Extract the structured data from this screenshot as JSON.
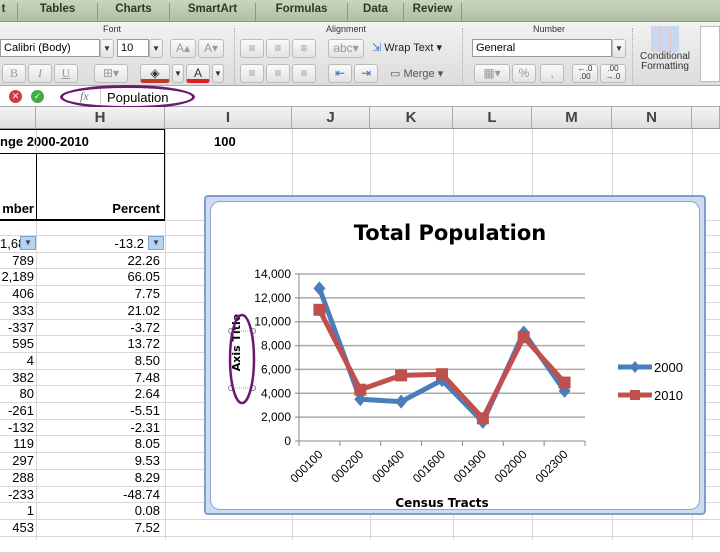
{
  "ribbon": {
    "tabs": [
      "t",
      "Tables",
      "Charts",
      "SmartArt",
      "Formulas",
      "Data",
      "Review"
    ],
    "groups": {
      "font": "Font",
      "alignment": "Alignment",
      "number": "Number"
    },
    "font_name": "Calibri (Body)",
    "font_size": "10",
    "bold": "B",
    "italic": "I",
    "underline": "U",
    "wrap_text": "Wrap Text",
    "merge": "Merge",
    "number_format": "General",
    "percent": "%",
    "comma": ",",
    "conditional_formatting": [
      "Conditional",
      "Formatting"
    ],
    "icons": [
      "increase-font-icon",
      "decrease-font-icon",
      "borders-icon",
      "fill-color-icon",
      "font-color-icon",
      "align-icons",
      "indent-icons",
      "wrap-text-icon",
      "merge-icon",
      "currency-icon",
      "increase-decimal-icon",
      "decrease-decimal-icon",
      "conditional-formatting-icon"
    ],
    "fill_color": "#c0392b",
    "font_color": "#e02020"
  },
  "formula_bar": {
    "fx": "fx",
    "value": "Population",
    "highlight_color": "#6a1b6e"
  },
  "columns": [
    "H",
    "I",
    "J",
    "K",
    "L",
    "M",
    "N"
  ],
  "sheet": {
    "header_title": "nge 2000-2010",
    "i1_value": "100",
    "col_g_header": "mber",
    "col_h_header": "Percent",
    "number_col": [
      "1,68",
      "789",
      "2,189",
      "406",
      "333",
      "-337",
      "595",
      "4",
      "382",
      "80",
      "-261",
      "-132",
      "119",
      "297",
      "288",
      "-233",
      "1",
      "453"
    ],
    "percent_col": [
      "-13.2",
      "22.26",
      "66.05",
      "7.75",
      "21.02",
      "-3.72",
      "13.72",
      "8.50",
      "7.48",
      "2.64",
      "-5.51",
      "-2.31",
      "8.05",
      "9.53",
      "8.29",
      "-48.74",
      "0.08",
      "7.52"
    ]
  },
  "chart_data": {
    "type": "line",
    "title": "Total Population",
    "xlabel": "Census Tracts",
    "ylabel": "Axis Title",
    "categories": [
      "000100",
      "000200",
      "000400",
      "001600",
      "001900",
      "002000",
      "002300"
    ],
    "ylim": [
      0,
      14000
    ],
    "yticks": [
      "0",
      "2,000",
      "4,000",
      "6,000",
      "8,000",
      "10,000",
      "12,000",
      "14,000"
    ],
    "grid": true,
    "legend_position": "right",
    "series": [
      {
        "name": "2000",
        "color": "#4a7ebb",
        "marker": "diamond",
        "values": [
          12800,
          3500,
          3300,
          5100,
          1600,
          9100,
          4200
        ]
      },
      {
        "name": "2010",
        "color": "#c0504d",
        "marker": "square",
        "values": [
          11000,
          4300,
          5500,
          5600,
          1900,
          8700,
          4900
        ]
      }
    ]
  }
}
